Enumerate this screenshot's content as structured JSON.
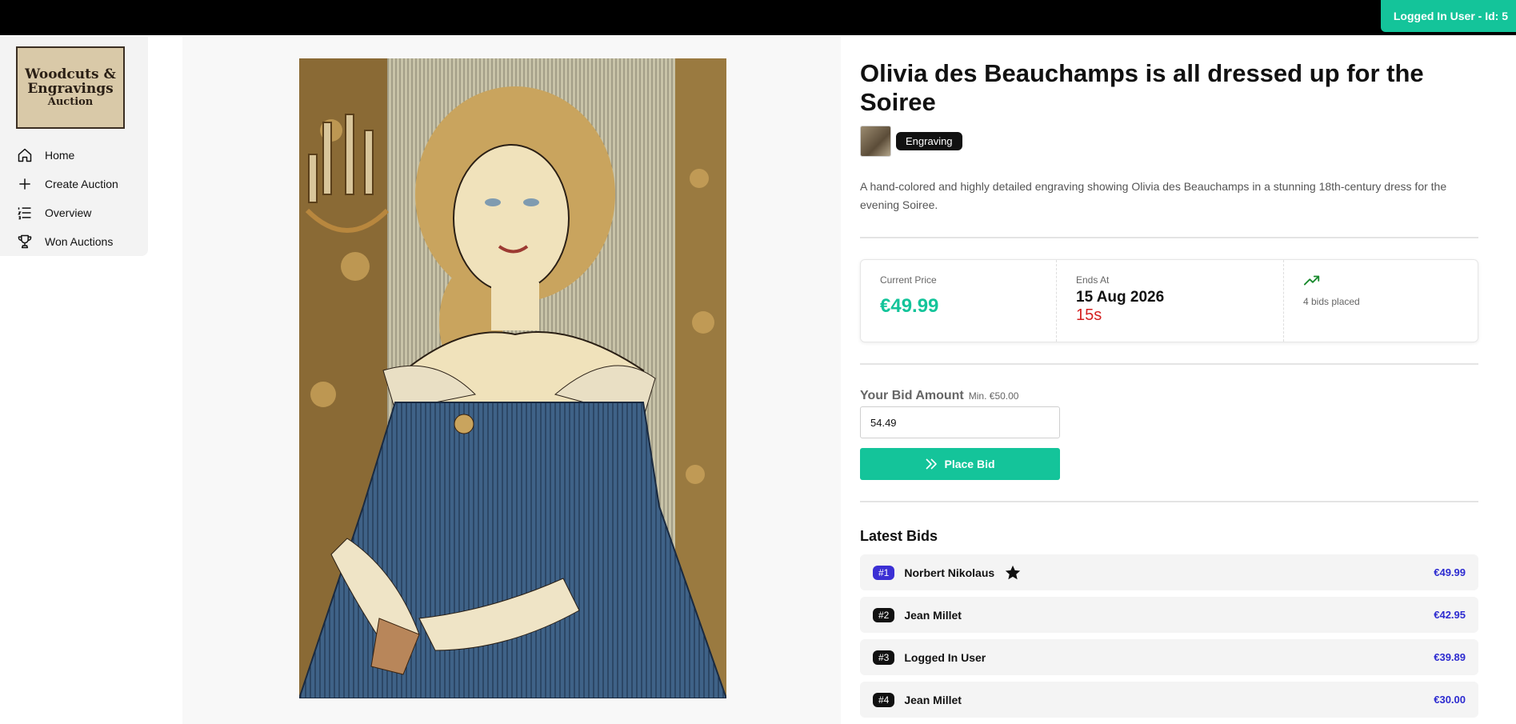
{
  "header": {
    "user_badge": "Logged In User - Id: 5"
  },
  "sidebar": {
    "logo": {
      "line1": "Woodcuts &",
      "line2": "Engravings",
      "line3": "Auction"
    },
    "items": [
      {
        "label": "Home",
        "icon": "home-icon"
      },
      {
        "label": "Create Auction",
        "icon": "plus-icon"
      },
      {
        "label": "Overview",
        "icon": "list-icon"
      },
      {
        "label": "Won Auctions",
        "icon": "trophy-icon"
      }
    ]
  },
  "auction": {
    "title": "Olivia des Beauchamps is all dressed up for the Soiree",
    "category": "Engraving",
    "description": "A hand-colored and highly detailed engraving showing Olivia des Beauchamps in a stunning 18th-century dress for the evening Soiree.",
    "stats": {
      "current_price_label": "Current Price",
      "current_price": "€49.99",
      "ends_label": "Ends At",
      "ends_date": "15 Aug 2026",
      "countdown": "15s",
      "bids_placed": "4 bids placed"
    },
    "bid_form": {
      "label": "Your Bid Amount",
      "min": "Min. €50.00",
      "value": "54.49",
      "button": "Place Bid"
    },
    "latest_bids": {
      "title": "Latest Bids",
      "rows": [
        {
          "rank": "#1",
          "name": "Norbert Nikolaus",
          "amount": "€49.99"
        },
        {
          "rank": "#2",
          "name": "Jean Millet",
          "amount": "€42.95"
        },
        {
          "rank": "#3",
          "name": "Logged In User",
          "amount": "€39.89"
        },
        {
          "rank": "#4",
          "name": "Jean Millet",
          "amount": "€30.00"
        }
      ]
    }
  },
  "colors": {
    "accent": "#14c49a",
    "countdown": "#d42020",
    "bid_amount": "#2d2bd0",
    "first_rank": "#3b2fd4"
  }
}
